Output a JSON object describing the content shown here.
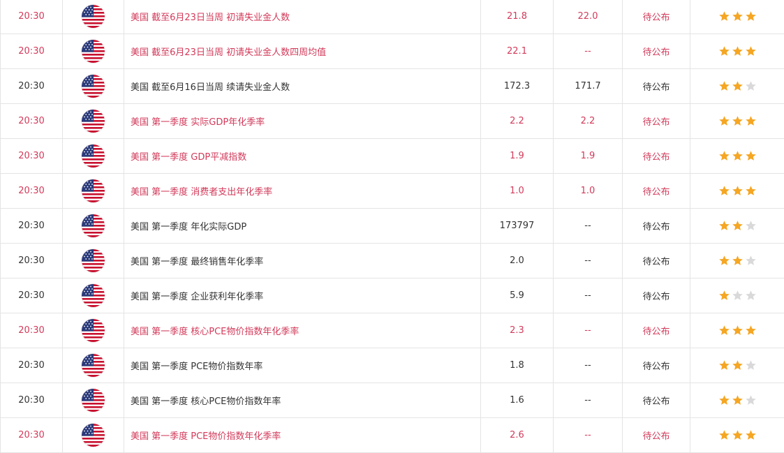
{
  "colors": {
    "highlight": "#d23a5a",
    "normal": "#333333",
    "star_on": "#f5a623",
    "star_off": "#d9d9d9",
    "border": "#e4e4e4"
  },
  "rows": [
    {
      "time": "20:30",
      "flag": "us-flag-icon",
      "name": "美国 截至6月23日当周 初请失业金人数",
      "previous": "21.8",
      "forecast": "22.0",
      "actual": "待公布",
      "stars": 3,
      "highlight": true
    },
    {
      "time": "20:30",
      "flag": "us-flag-icon",
      "name": "美国 截至6月23日当周 初请失业金人数四周均值",
      "previous": "22.1",
      "forecast": "--",
      "actual": "待公布",
      "stars": 3,
      "highlight": true
    },
    {
      "time": "20:30",
      "flag": "us-flag-icon",
      "name": "美国 截至6月16日当周 续请失业金人数",
      "previous": "172.3",
      "forecast": "171.7",
      "actual": "待公布",
      "stars": 2,
      "highlight": false
    },
    {
      "time": "20:30",
      "flag": "us-flag-icon",
      "name": "美国 第一季度 实际GDP年化季率",
      "previous": "2.2",
      "forecast": "2.2",
      "actual": "待公布",
      "stars": 3,
      "highlight": true
    },
    {
      "time": "20:30",
      "flag": "us-flag-icon",
      "name": "美国 第一季度 GDP平减指数",
      "previous": "1.9",
      "forecast": "1.9",
      "actual": "待公布",
      "stars": 3,
      "highlight": true
    },
    {
      "time": "20:30",
      "flag": "us-flag-icon",
      "name": "美国 第一季度 消费者支出年化季率",
      "previous": "1.0",
      "forecast": "1.0",
      "actual": "待公布",
      "stars": 3,
      "highlight": true
    },
    {
      "time": "20:30",
      "flag": "us-flag-icon",
      "name": "美国 第一季度 年化实际GDP",
      "previous": "173797",
      "forecast": "--",
      "actual": "待公布",
      "stars": 2,
      "highlight": false
    },
    {
      "time": "20:30",
      "flag": "us-flag-icon",
      "name": "美国 第一季度 最终销售年化季率",
      "previous": "2.0",
      "forecast": "--",
      "actual": "待公布",
      "stars": 2,
      "highlight": false
    },
    {
      "time": "20:30",
      "flag": "us-flag-icon",
      "name": "美国 第一季度 企业获利年化季率",
      "previous": "5.9",
      "forecast": "--",
      "actual": "待公布",
      "stars": 1,
      "highlight": false
    },
    {
      "time": "20:30",
      "flag": "us-flag-icon",
      "name": "美国 第一季度 核心PCE物价指数年化季率",
      "previous": "2.3",
      "forecast": "--",
      "actual": "待公布",
      "stars": 3,
      "highlight": true
    },
    {
      "time": "20:30",
      "flag": "us-flag-icon",
      "name": "美国 第一季度 PCE物价指数年率",
      "previous": "1.8",
      "forecast": "--",
      "actual": "待公布",
      "stars": 2,
      "highlight": false
    },
    {
      "time": "20:30",
      "flag": "us-flag-icon",
      "name": "美国 第一季度 核心PCE物价指数年率",
      "previous": "1.6",
      "forecast": "--",
      "actual": "待公布",
      "stars": 2,
      "highlight": false
    },
    {
      "time": "20:30",
      "flag": "us-flag-icon",
      "name": "美国 第一季度 PCE物价指数年化季率",
      "previous": "2.6",
      "forecast": "--",
      "actual": "待公布",
      "stars": 3,
      "highlight": true
    }
  ]
}
